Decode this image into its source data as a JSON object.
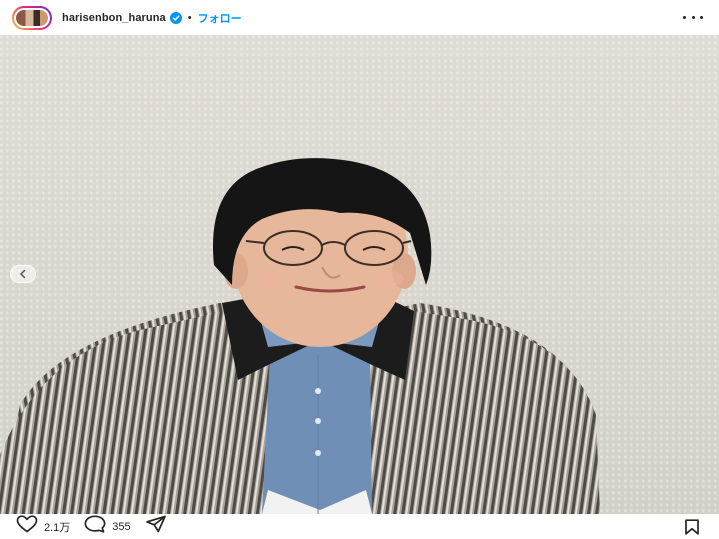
{
  "header": {
    "username": "harisenbon_haruna",
    "separator": "•",
    "follow_label": "フォロー"
  },
  "post": {
    "likes": "2.1万",
    "comments": "355"
  },
  "icons": {
    "verified": "verified-badge-icon",
    "more": "more-options-icon",
    "prev": "chevron-left-icon",
    "like": "heart-icon",
    "comment": "comment-bubble-icon",
    "share": "send-icon",
    "save": "bookmark-icon"
  },
  "colors": {
    "accent": "#0095f6",
    "text": "#262626"
  }
}
